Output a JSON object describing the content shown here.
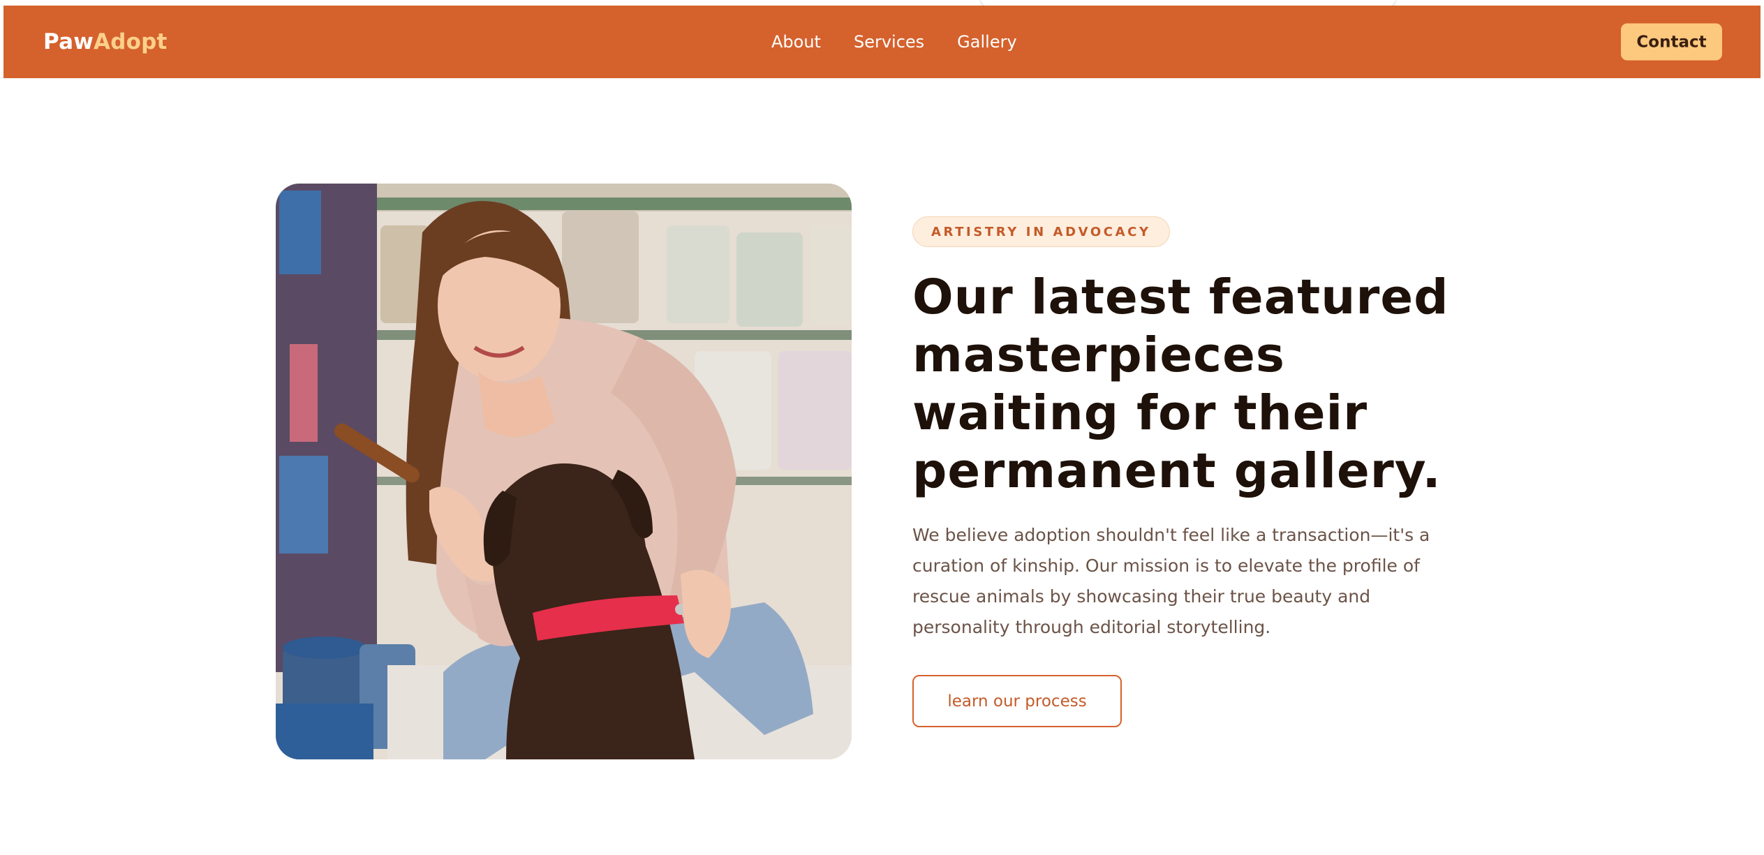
{
  "header": {
    "logo_part1": "Paw",
    "logo_part2": "Adopt",
    "nav": [
      "About",
      "Services",
      "Gallery"
    ],
    "contact_label": "Contact"
  },
  "hero": {
    "eyebrow": "ARTISTRY IN ADVOCACY",
    "headline": "Our latest featured masterpieces waiting for their permanent gallery.",
    "body": "We believe adoption shouldn't feel like a transaction—it's a curation of kinship. Our mission is to elevate the profile of rescue animals by showcasing their true beauty and personality through editorial storytelling.",
    "cta_label": "learn our process",
    "photo_icon": "photo-woman-feeding-dog-icon"
  },
  "colors": {
    "brand": "#d5612d",
    "accent": "#fcc97e",
    "logo_accent": "#fcd08a",
    "heading": "#1e1109",
    "body_text": "#6b5347"
  }
}
